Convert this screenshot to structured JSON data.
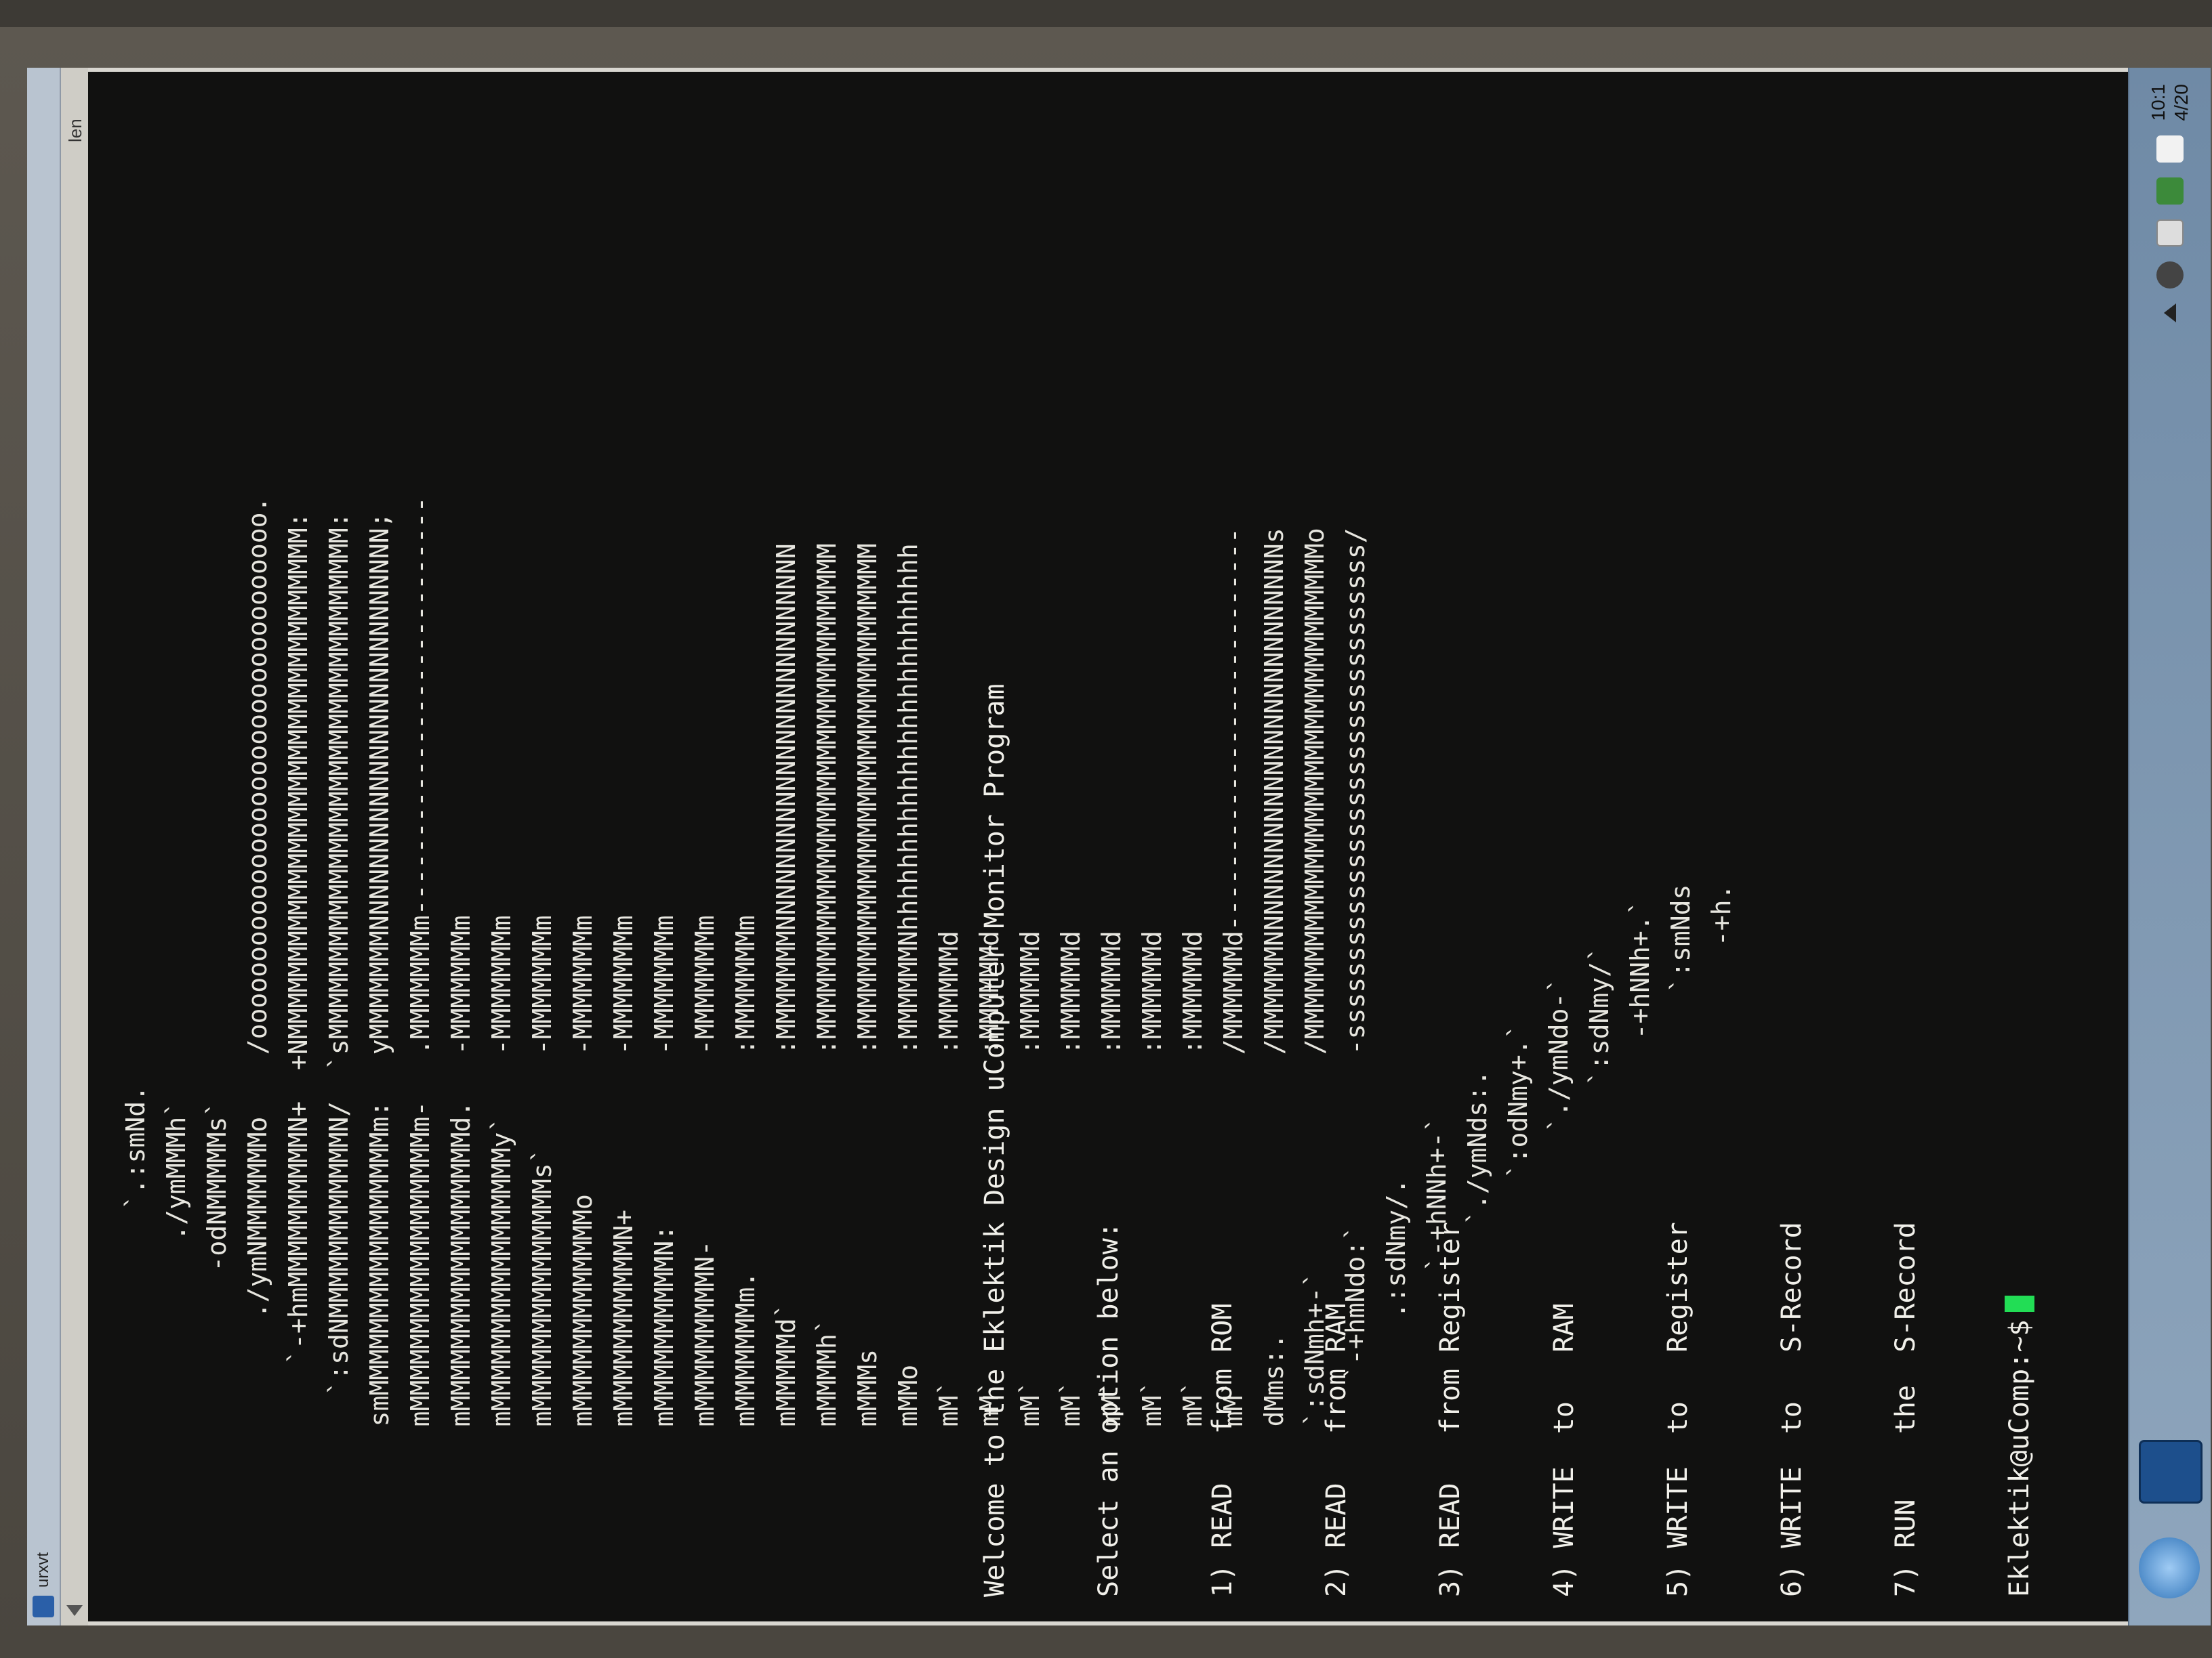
{
  "window": {
    "title": "urxvt"
  },
  "ascii_art": [
    "",
    "                         `.:smNd.",
    "                       ./ymMMMh`",
    "                     -odNMMMMMs`",
    "                  ./ymNMMMMMMMo    /oooooooooooooooooooooooooooooooooo.",
    "               `-+hmMMMMMMMMMMN+  +NMMMMMMMMMMMMMMMMMMMMMMMMMMMMMMMMM:",
    "             `:sdNMMMMMMMMMMMMN/  `sMMMMMMMMMMMMMMMMMMMMMMMMMMMMMMMMM:",
    "           smMMMMMMMMMMMMMMMMMm:   yMMMMMMMNNNNNNNNNNNNNNNNNNNNNNNNNN;",
    "           mMMMMMMMMMMMMMMMMMMm-   .MMMMMMMm---------------------------",
    "           mMMMMMMMMMMMMMMMMMMd.   -MMMMMMMm",
    "           mMMMMMMMMMMMMMMMMMy`    -MMMMMMMm",
    "           mMMMMMMMMMMMMMMMs`      -MMMMMMMm",
    "           mMMMMMMMMMMMMMo         -MMMMMMMm",
    "           mMMMMMMMMMMMN+          -MMMMMMMm",
    "           mMMMMMMMMMMN:           -MMMMMMMm",
    "           mMMMMMMMMMN-            -MMMMMMMm",
    "           mMMMMMMMm.              :MMMMMMMm",
    "           mMMMMMd`                :MMMMMMMNNNNNNNNNNNNNNNNNNNNNNNNN",
    "           mMMMMh`                 :MMMMMMMMMMMMMMMMMMMMMMMMMMMMMMMM",
    "           mMMMs                   :MMMMMMMMMMMMMMMMMMMMMMMMMMMMMMMM",
    "           mMMo                    :MMMMMMNhhhhhhhhhhhhhhhhhhhhhhhhh",
    "           mM`                     :MMMMMMd",
    "           mM`                     :MMMMMMd",
    "           mM`                     :MMMMMMd",
    "           mM`                     :MMMMMMd",
    "           mM`                     :MMMMMMd",
    "           mM`                     :MMMMMMd",
    "           mM`                     :MMMMMMd",
    "           mM`                     /MMMMMMd--------------------------",
    "           dMms:.                  /MMMMMMNNNNNNNNNNNNNNNNNNNNNNNNNNs",
    "           `:sdNmh+-`              /MMMMMMMMMMMMMMMMMMMMMMMMMMMMMMMMo",
    "              `-+hmNdo:`           -ssssssssssssssssssssssssssssssss/",
    "                  .:sdNmy/.",
    "                     `-+hNNh+-`",
    "                        `./ymNds:.",
    "                           `:odNmy+.`",
    "                              `./ymNdo-`",
    "                                 `:sdNmy/`",
    "                                    -+hNNh+.`",
    "                                       `:smNds",
    "                                          -+h."
  ],
  "menu": {
    "welcome": "Welcome to the Eklektik Design uComputer Monitor Program",
    "select": "Select an option below:",
    "options": [
      "1) READ   from ROM",
      "2) READ   from RAM",
      "3) READ   from Register",
      "4) WRITE  to   RAM",
      "5) WRITE  to   Register",
      "6) WRITE  to   S-Record",
      "7) RUN    the  S-Record"
    ],
    "prompt": "Eklektik@uComp:~$"
  },
  "taskbar": {
    "clock_time": "10:1",
    "clock_date": "4/20"
  },
  "side_label": "len",
  "colors": {
    "terminal_bg": "#111110",
    "text": "#e7e6df",
    "cursor": "#22dd55"
  }
}
